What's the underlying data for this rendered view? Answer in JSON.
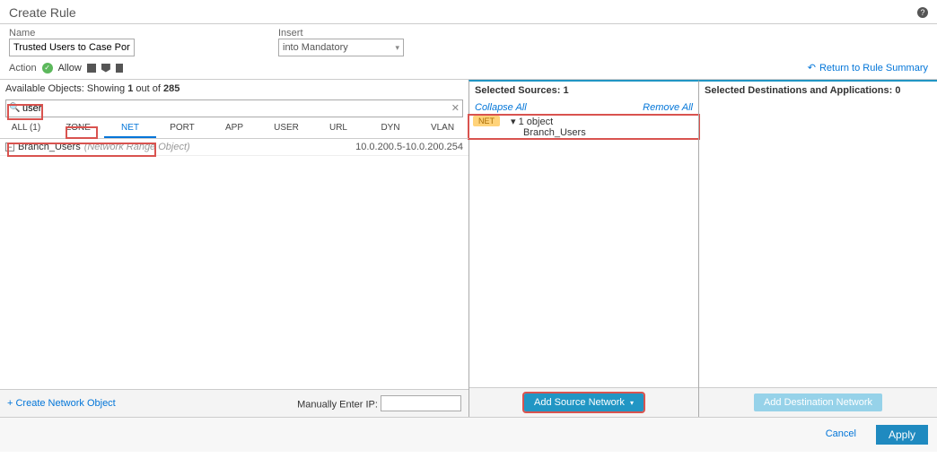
{
  "header": {
    "title": "Create Rule"
  },
  "form": {
    "name_label": "Name",
    "name_value": "Trusted Users to Case Portal",
    "insert_label": "Insert",
    "insert_value": "into Mandatory"
  },
  "action": {
    "label": "Action",
    "value": "Allow"
  },
  "return_link": "Return to Rule Summary",
  "available": {
    "header": "Available Objects:",
    "showing_prefix": "Showing ",
    "showing_count": "1",
    "showing_mid": " out of ",
    "showing_total": "285",
    "search_value": "user",
    "tabs": [
      "ALL (1)",
      "ZONE",
      "NET",
      "PORT",
      "APP",
      "USER",
      "URL",
      "DYN",
      "VLAN"
    ],
    "active_tab": 2,
    "row": {
      "name": "Branch_Users",
      "type": "(Network Range Object)",
      "range": "10.0.200.5-10.0.200.254"
    },
    "create_link": "+ Create Network Object",
    "manual_label": "Manually Enter IP:"
  },
  "selected_src": {
    "header": "Selected Sources:",
    "count": "1",
    "collapse": "Collapse All",
    "remove": "Remove All",
    "badge": "NET",
    "line1": "1 object",
    "line2": "Branch_Users",
    "add_btn": "Add Source Network"
  },
  "selected_dst": {
    "header": "Selected Destinations and Applications:",
    "count": "0",
    "add_btn": "Add Destination Network"
  },
  "footer": {
    "cancel": "Cancel",
    "apply": "Apply"
  }
}
